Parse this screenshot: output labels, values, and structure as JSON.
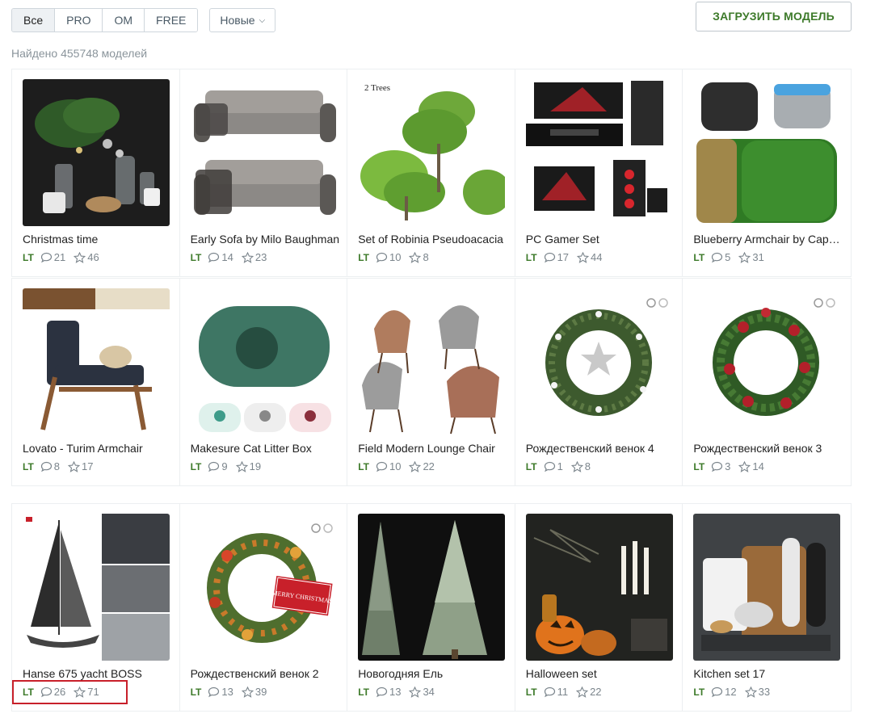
{
  "filters": {
    "tabs": [
      {
        "label": "Все",
        "active": true
      },
      {
        "label": "PRO",
        "active": false
      },
      {
        "label": "OM",
        "active": false
      },
      {
        "label": "FREE",
        "active": false
      }
    ],
    "sort_label": "Новые",
    "upload_label": "ЗАГРУЗИТЬ МОДЕЛЬ"
  },
  "found_text": "Найдено 455748 моделей",
  "models": [
    {
      "title": "Christmas time",
      "badge": "LT",
      "comments": "21",
      "stars": "46",
      "thumb": "dark-vases"
    },
    {
      "title": "Early Sofa by Milo Baughman",
      "badge": "LT",
      "comments": "14",
      "stars": "23",
      "thumb": "sofa"
    },
    {
      "title": "Set of Robinia Pseudoacacia",
      "badge": "LT",
      "comments": "10",
      "stars": "8",
      "thumb": "trees",
      "thumb_text": "2 Trees"
    },
    {
      "title": "PC Gamer Set",
      "badge": "LT",
      "comments": "17",
      "stars": "44",
      "thumb": "pc"
    },
    {
      "title": "Blueberry Armchair by Cappellini",
      "badge": "LT",
      "comments": "5",
      "stars": "31",
      "thumb": "armchair-green"
    },
    {
      "title": "Lovato - Turim Armchair",
      "badge": "LT",
      "comments": "8",
      "stars": "17",
      "thumb": "armchair-wood"
    },
    {
      "title": "Makesure Cat Litter Box",
      "badge": "LT",
      "comments": "9",
      "stars": "19",
      "thumb": "litter-box"
    },
    {
      "title": "Field Modern Lounge Chair",
      "badge": "LT",
      "comments": "10",
      "stars": "22",
      "thumb": "lounge-chairs"
    },
    {
      "title": "Рождественский венок 4",
      "badge": "LT",
      "comments": "1",
      "stars": "8",
      "thumb": "wreath-stars"
    },
    {
      "title": "Рождественский венок 3",
      "badge": "LT",
      "comments": "3",
      "stars": "14",
      "thumb": "wreath-red"
    },
    {
      "title": "Hanse 675 yacht BOSS",
      "badge": "LT",
      "comments": "26",
      "stars": "71",
      "thumb": "yacht"
    },
    {
      "title": "Рождественский венок 2",
      "badge": "LT",
      "comments": "13",
      "stars": "39",
      "thumb": "wreath-merry",
      "thumb_text": "MERRY CHRISTMAS"
    },
    {
      "title": "Новогодняя Ель",
      "badge": "LT",
      "comments": "13",
      "stars": "34",
      "thumb": "fir-trees"
    },
    {
      "title": "Halloween set",
      "badge": "LT",
      "comments": "11",
      "stars": "22",
      "thumb": "halloween"
    },
    {
      "title": "Kitchen set 17",
      "badge": "LT",
      "comments": "12",
      "stars": "33",
      "thumb": "kitchen"
    }
  ],
  "colors": {
    "accent_green": "#3d7a2a",
    "highlight_red": "#c8202a"
  }
}
